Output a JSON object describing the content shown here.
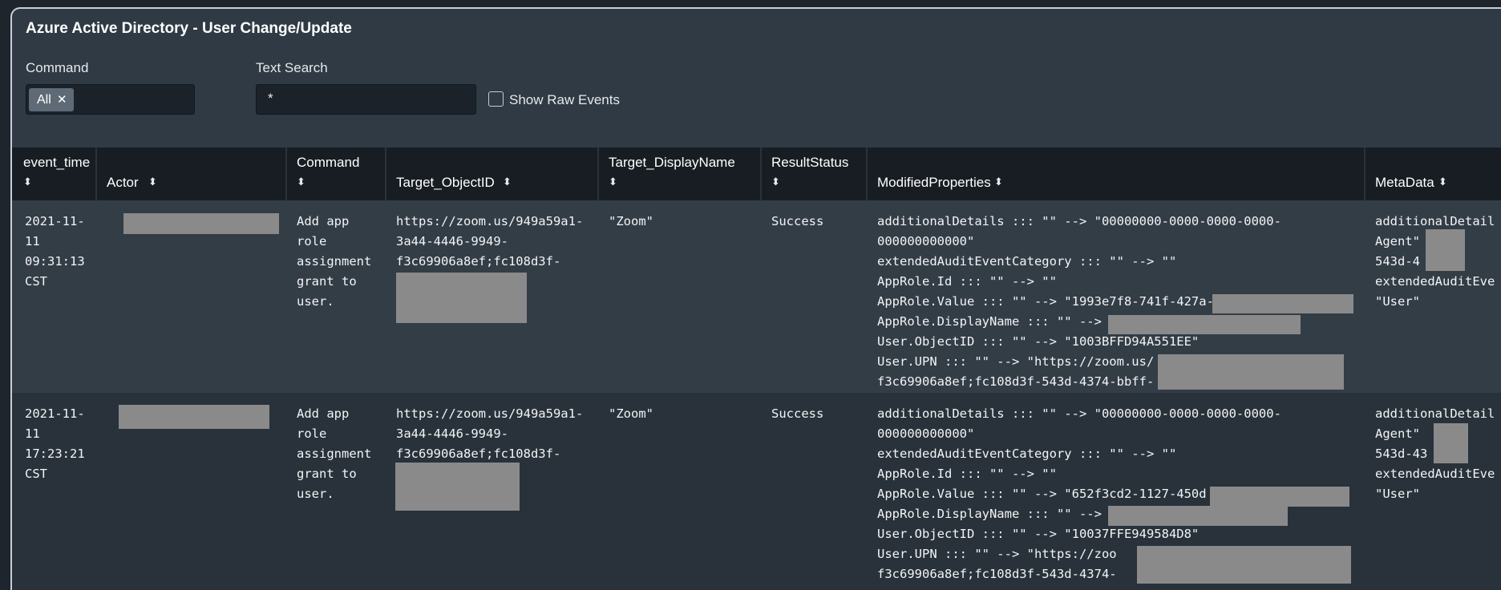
{
  "title": "Azure Active Directory - User Change/Update",
  "filters": {
    "command_label": "Command",
    "command_token": "All",
    "command_token_remove": "✕",
    "text_search_label": "Text Search",
    "text_search_value": "*",
    "raw_events_label": "Show Raw Events"
  },
  "table": {
    "sort_icon": "⬍",
    "columns": [
      "event_time",
      "Actor",
      "Command",
      "Target_ObjectID",
      "Target_DisplayName",
      "ResultStatus",
      "ModifiedProperties",
      "MetaData"
    ],
    "rows": [
      {
        "event_time": "2021-11-\n11\n09:31:13\nCST",
        "command": "Add app\nrole\nassignment\ngrant to\nuser.",
        "target_objectid": "https://zoom.us/949a59a1-\n3a44-4446-9949-\nf3c69906a8ef;fc108d3f-",
        "target_displayname": "\"Zoom\"",
        "resultstatus": "Success",
        "modifiedproperties": "additionalDetails ::: \"\" --> \"00000000-0000-0000-0000-\n000000000000\"\nextendedAuditEventCategory ::: \"\" --> \"\"\nAppRole.Id ::: \"\" --> \"\"\nAppRole.Value ::: \"\" --> \"1993e7f8-741f-427a-\nAppRole.DisplayName ::: \"\" -->\nUser.ObjectID ::: \"\" --> \"1003BFFD94A551EE\"\nUser.UPN ::: \"\" --> \"https://zoom.us/\nf3c69906a8ef;fc108d3f-543d-4374-bbff-",
        "metadata": "additionalDetail\nAgent\"\n543d-4\nextendedAuditEve\n\"User\""
      },
      {
        "event_time": "2021-11-\n11\n17:23:21\nCST",
        "command": "Add app\nrole\nassignment\ngrant to\nuser.",
        "target_objectid": "https://zoom.us/949a59a1-\n3a44-4446-9949-\nf3c69906a8ef;fc108d3f-",
        "target_displayname": "\"Zoom\"",
        "resultstatus": "Success",
        "modifiedproperties": "additionalDetails ::: \"\" --> \"00000000-0000-0000-0000-\n000000000000\"\nextendedAuditEventCategory ::: \"\" --> \"\"\nAppRole.Id ::: \"\" --> \"\"\nAppRole.Value ::: \"\" --> \"652f3cd2-1127-450d\nAppRole.DisplayName ::: \"\" -->\nUser.ObjectID ::: \"\" --> \"10037FFE949584D8\"\nUser.UPN ::: \"\" --> \"https://zoo\nf3c69906a8ef;fc108d3f-543d-4374-",
        "metadata": "additionalDetail\nAgent\"\n543d-43\nextendedAuditEve\n\"User\""
      }
    ]
  }
}
